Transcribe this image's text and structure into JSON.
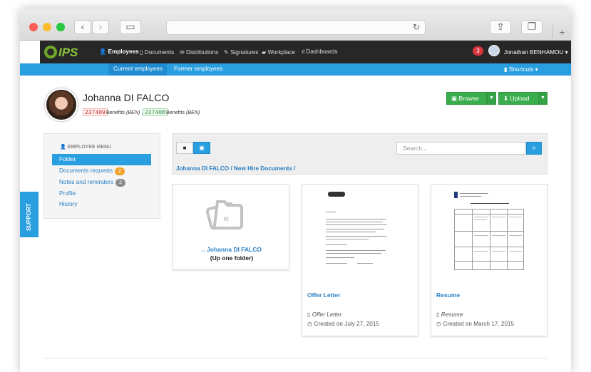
{
  "nav": {
    "employees": "Employees",
    "documents": "Documents",
    "distributions": "Distributions",
    "signatures": "Signatures",
    "workplace": "Workplace",
    "dashboards": "Dashboards",
    "notifications": "3",
    "user": "Jonathan BENHAMOU"
  },
  "subnav": {
    "current": "Current employees",
    "former": "Former employees",
    "shortcuts": "Shortcuts"
  },
  "logo": {
    "text": "IPS"
  },
  "employee": {
    "name": "Johanna DI FALCO",
    "id1": "237409",
    "benefits1": "Benefits",
    "ben1": "(BEN)",
    "sep": ",",
    "id2": "237408",
    "benefits2": "Benefits",
    "ben2": "(BEN)"
  },
  "buttons": {
    "browse": "Browse",
    "upload": "Upload"
  },
  "menu": {
    "header": "EMPLOYEE MENU",
    "items": [
      "Folder",
      "Documents requests",
      "Notes and reminders",
      "Profile",
      "History"
    ],
    "requests_count": "2",
    "notes_count": "2"
  },
  "support": "SUPPORT",
  "search": {
    "placeholder": "Search..."
  },
  "breadcrumb": {
    "root": "Johanna DI FALCO",
    "sep": "/",
    "folder": "New Hire Documents",
    "end": "/"
  },
  "cards": [
    {
      "title": ".. Johanna DI FALCO",
      "subtitle": "(Up one folder)"
    },
    {
      "title": "Offer Letter",
      "type": "Offer Letter",
      "created": "Created on July 27, 2015"
    },
    {
      "title": "Resume",
      "type": "Resume",
      "created": "Created on March 17, 2015"
    }
  ],
  "colors": {
    "accent": "#2a9fe0",
    "nav": "#272727",
    "green": "#3aad4c"
  }
}
